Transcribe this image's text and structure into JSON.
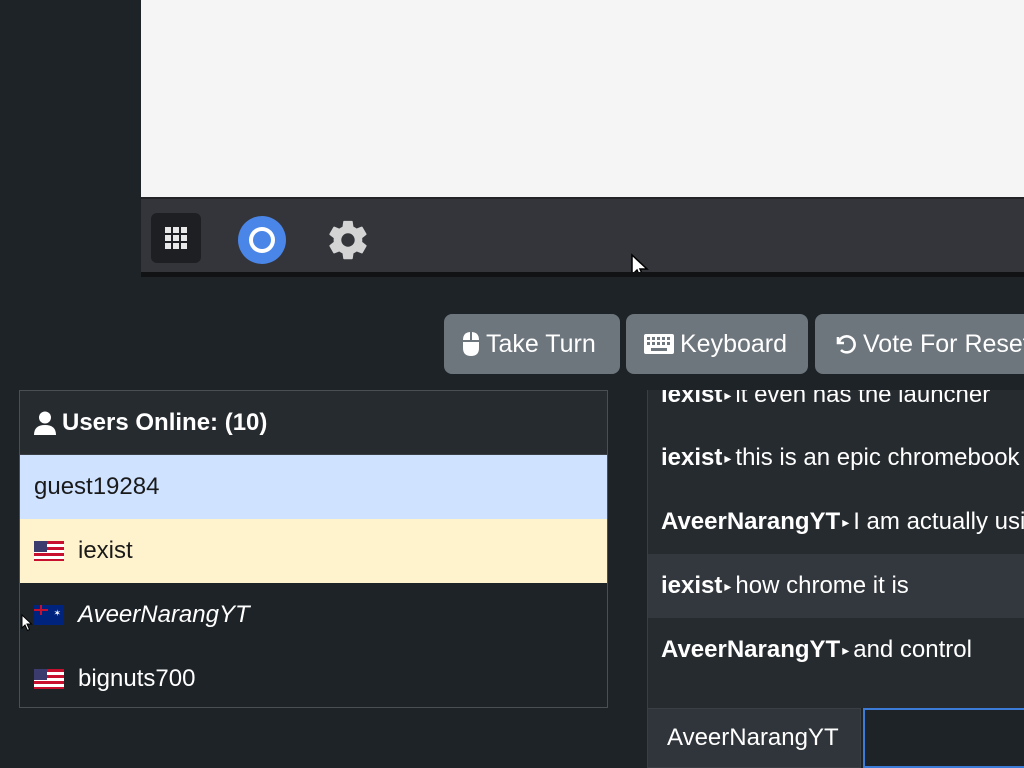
{
  "vm": {
    "shelf": {
      "launcher_icon": "app-launcher-grid-icon",
      "apps": [
        {
          "name": "chrome",
          "icon": "chrome-icon"
        },
        {
          "name": "settings",
          "icon": "gear-icon"
        }
      ]
    }
  },
  "toolbar": {
    "take_turn_label": "Take Turn",
    "take_turn_icon": "mouse-icon",
    "keyboard_label": "Keyboard",
    "keyboard_icon": "keyboard-icon",
    "vote_label": "Vote For Reset",
    "vote_icon": "undo-icon"
  },
  "users": {
    "header_label": "Users Online: (10)",
    "header_icon": "user-icon",
    "list": [
      {
        "name": "guest19284",
        "flag": "",
        "state": "self"
      },
      {
        "name": "iexist",
        "flag": "us",
        "state": "turn"
      },
      {
        "name": "AveerNarangYT",
        "flag": "au",
        "state": "waiting"
      },
      {
        "name": "bignuts700",
        "flag": "us",
        "state": "normal"
      }
    ]
  },
  "chat": {
    "messages": [
      {
        "sender": "iexist",
        "text": "it even has the launcher"
      },
      {
        "sender": "iexist",
        "text": "this is an epic chromebook"
      },
      {
        "sender": "AveerNarangYT",
        "text": "I am actually using"
      },
      {
        "sender": "iexist",
        "text": "how chrome it is"
      },
      {
        "sender": "AveerNarangYT",
        "text": "and control"
      }
    ],
    "username": "AveerNarangYT",
    "input_value": ""
  },
  "colors": {
    "background": "#1e2327",
    "button": "#6d757d",
    "self_row": "#cfe2ff",
    "turn_row": "#fff3cd",
    "input_focus": "#3d7bd9"
  }
}
